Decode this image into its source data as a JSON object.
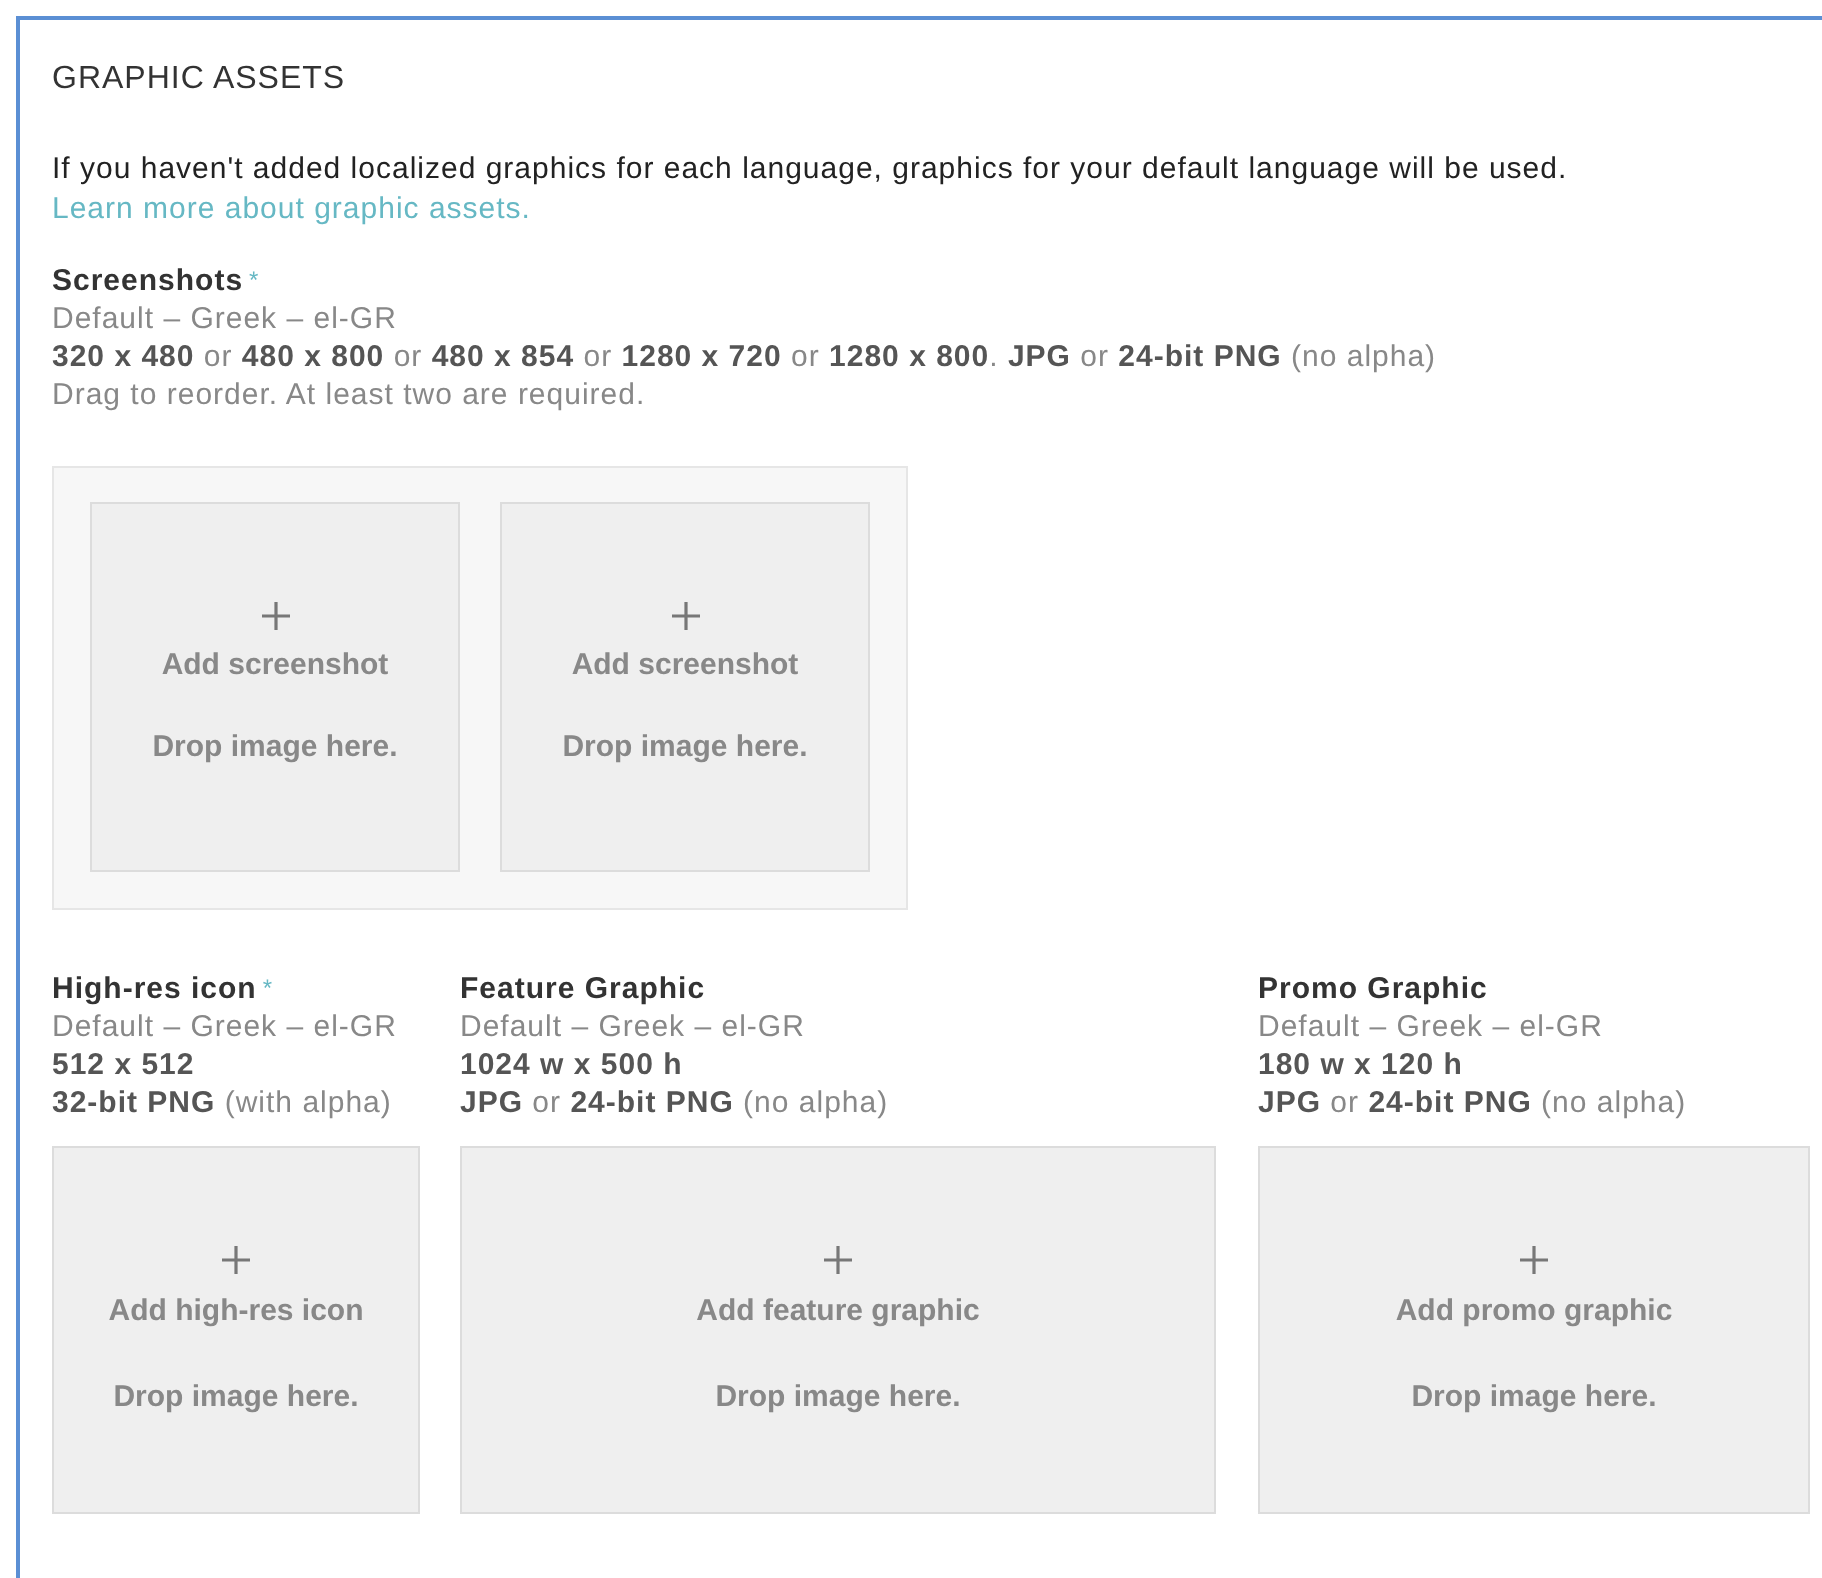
{
  "section_title": "GRAPHIC ASSETS",
  "intro": "If you haven't added localized graphics for each language, graphics for your default language will be used.",
  "learn_link": "Learn more about graphic assets.",
  "screenshots": {
    "title": "Screenshots",
    "required_mark": "*",
    "language": "Default – Greek – el-GR",
    "spec": "**320 x 480** or **480 x 800** or **480 x 854** or **1280 x 720** or **1280 x 800**. **JPG** or **24-bit PNG** (no alpha)",
    "note": "Drag to reorder. At least two are required.",
    "slots": [
      {
        "label": "Add screenshot",
        "hint": "Drop image here."
      },
      {
        "label": "Add screenshot",
        "hint": "Drop image here."
      }
    ]
  },
  "assets": [
    {
      "kind": "square",
      "title": "High-res icon",
      "required_mark": "*",
      "language": "Default – Greek – el-GR",
      "size": "512 x 512",
      "format": "**32-bit PNG** (with alpha)",
      "label": "Add high-res icon",
      "hint": "Drop image here."
    },
    {
      "kind": "wide",
      "title": "Feature Graphic",
      "language": "Default – Greek – el-GR",
      "size": "1024 w x 500 h",
      "format": "**JPG** or **24-bit PNG** (no alpha)",
      "label": "Add feature graphic",
      "hint": "Drop image here."
    },
    {
      "kind": "promo",
      "title": "Promo Graphic",
      "language": "Default – Greek – el-GR",
      "size": "180 w x 120 h",
      "format": "**JPG** or **24-bit PNG** (no alpha)",
      "label": "Add promo graphic",
      "hint": "Drop image here."
    }
  ]
}
